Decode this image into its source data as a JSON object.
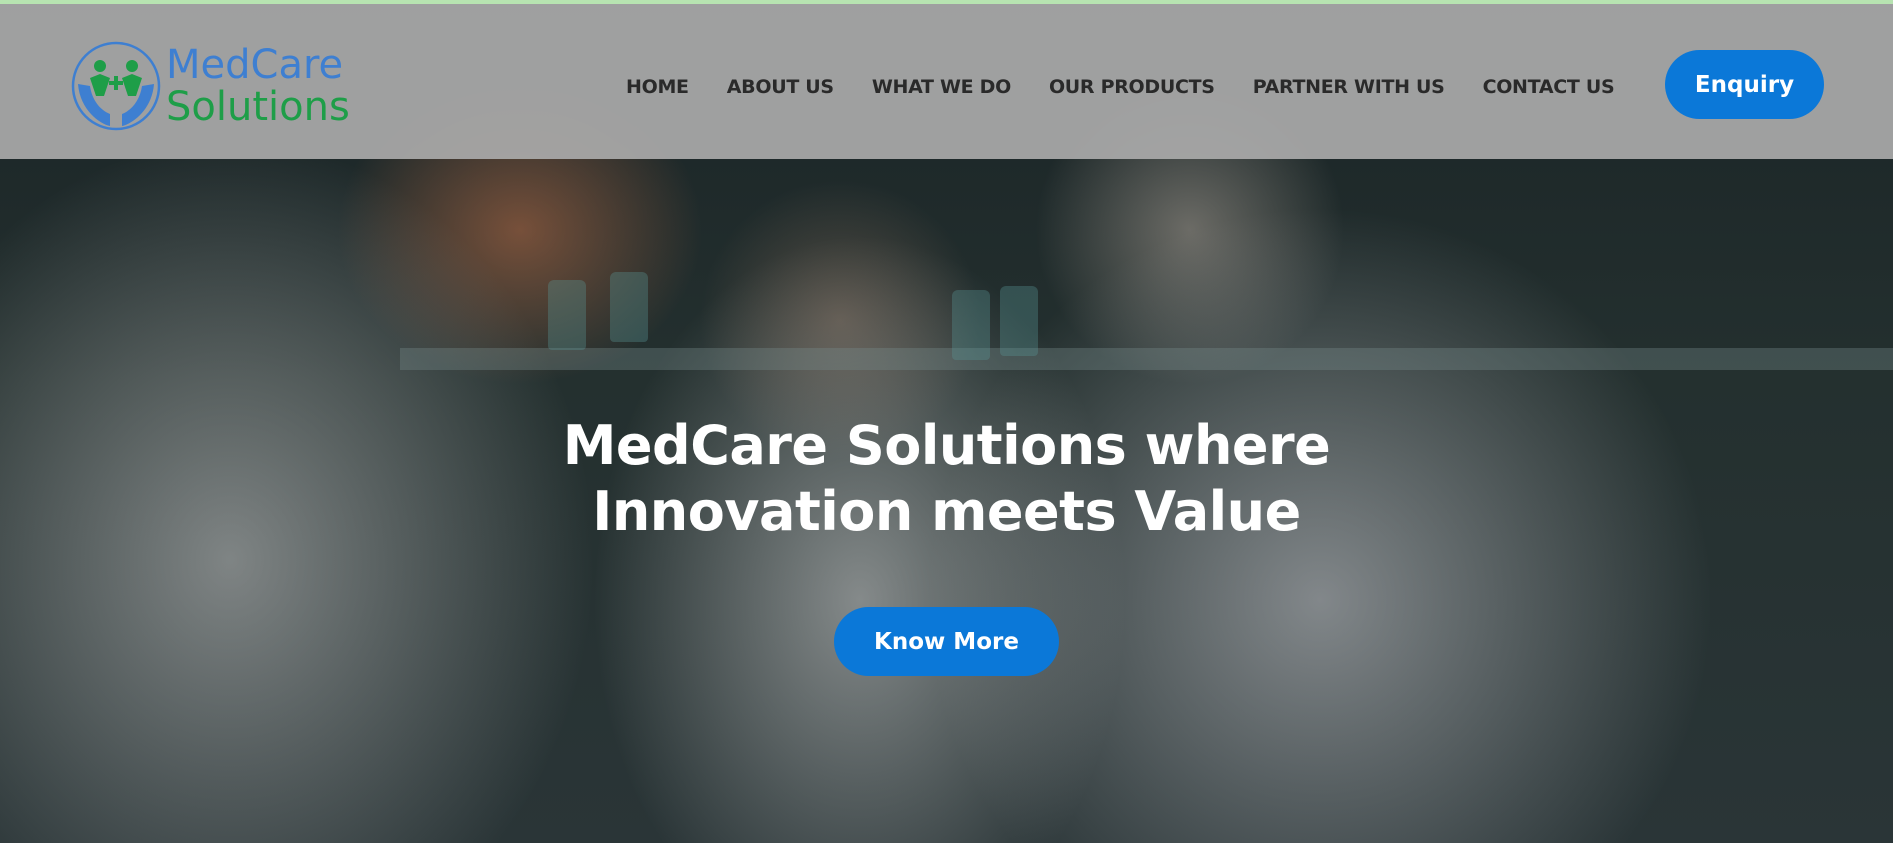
{
  "brand": {
    "name_line1": "MedCare",
    "name_line2": "Solutions",
    "icon": "hands-with-people-icon",
    "color_primary": "#3e7fd1",
    "color_secondary": "#1e9e48"
  },
  "nav": {
    "items": [
      {
        "label": "HOME"
      },
      {
        "label": "ABOUT US"
      },
      {
        "label": "WHAT WE DO"
      },
      {
        "label": "OUR PRODUCTS"
      },
      {
        "label": "PARTNER WITH US"
      },
      {
        "label": "CONTACT US"
      }
    ],
    "cta_label": "Enquiry"
  },
  "hero": {
    "headline_line1": "MedCare Solutions where",
    "headline_line2": "Innovation meets Value",
    "button_label": "Know More",
    "accent_color": "#0b78d8"
  }
}
